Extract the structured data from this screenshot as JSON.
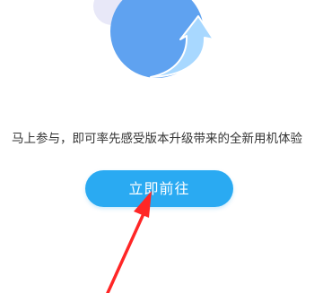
{
  "message": "马上参与，即可率先感受版本升级带来的全新用机体验",
  "cta_label": "立即前往",
  "colors": {
    "primary_circle": "#5fa2f0",
    "light_circle": "#e8e8f8",
    "arrow": "#a8d8ff",
    "button": "#2aaaf2",
    "annotation_arrow": "#ff2626"
  },
  "icons": {
    "illustration": "upgrade-circle-arrow-icon",
    "pointer": "red-pointer-arrow-icon"
  }
}
